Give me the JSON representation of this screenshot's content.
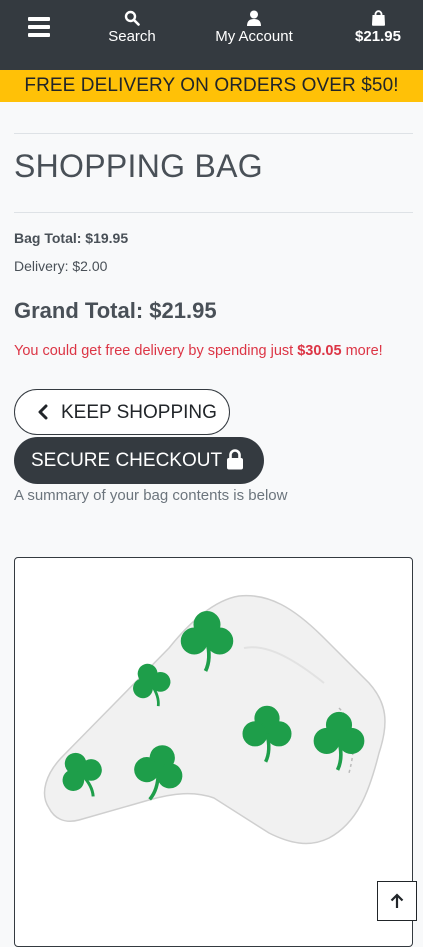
{
  "nav": {
    "search_label": "Search",
    "account_label": "My Account",
    "bag_total": "$21.95"
  },
  "banner": {
    "text": "FREE DELIVERY ON ORDERS OVER $50!"
  },
  "page": {
    "title": "SHOPPING BAG"
  },
  "totals": {
    "bag_total_label": "Bag Total:",
    "bag_total_value": "$19.95",
    "delivery_label": "Delivery:",
    "delivery_value": "$2.00",
    "grand_total_label": "Grand Total:",
    "grand_total_value": "$21.95"
  },
  "free_delivery": {
    "prefix": "You could get free delivery by spending just ",
    "amount": "$30.05",
    "suffix": " more!"
  },
  "buttons": {
    "keep_shopping": "KEEP SHOPPING",
    "secure_checkout": "SECURE CHECKOUT"
  },
  "summary_text": "A summary of your bag contents is below",
  "colors": {
    "nav_bg": "#343a40",
    "banner_bg": "#ffc107",
    "alert_red": "#dc3545",
    "clover_green": "#1e9e4a"
  },
  "icons": {
    "menu": "hamburger-menu-icon",
    "search": "search-icon",
    "account": "user-icon",
    "bag": "shopping-bag-icon",
    "keep_shopping": "chevron-left-icon",
    "checkout": "lock-icon",
    "back_to_top": "arrow-up-icon"
  }
}
